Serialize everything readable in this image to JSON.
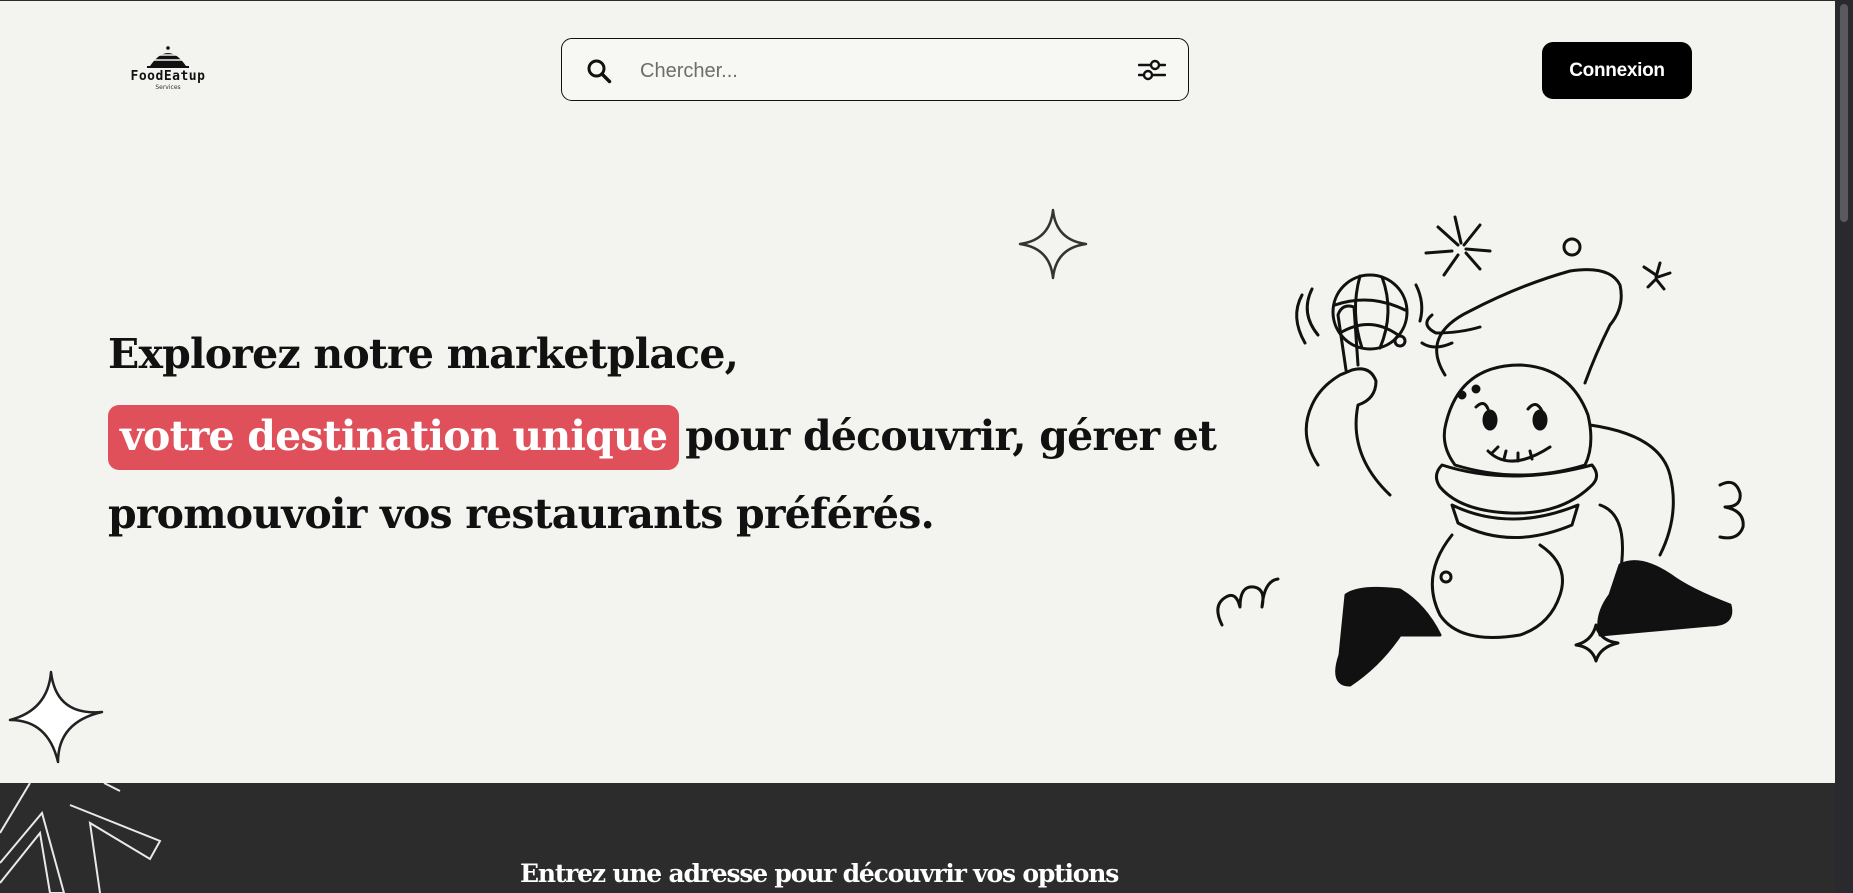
{
  "header": {
    "logo": {
      "name": "FoodEatup",
      "subtitle": "Services"
    },
    "search": {
      "placeholder": "Chercher...",
      "value": ""
    },
    "login_label": "Connexion"
  },
  "hero": {
    "line1": "Explorez notre marketplace,",
    "highlight": "votre destination unique",
    "line2_rest": "pour découvrir, gérer et",
    "line3": "promouvoir vos restaurants préférés."
  },
  "address_section": {
    "title": "Entrez une adresse pour découvrir vos options"
  },
  "icons": {
    "search": "search-icon",
    "filter": "sliders-icon",
    "sparkle": "sparkle-star-icon",
    "mascot": "burger-mascot-illustration"
  },
  "colors": {
    "background": "#f3f3ef",
    "accent": "#e0505a",
    "button": "#000000",
    "dark_section": "#2c2c2c",
    "text": "#111111"
  }
}
